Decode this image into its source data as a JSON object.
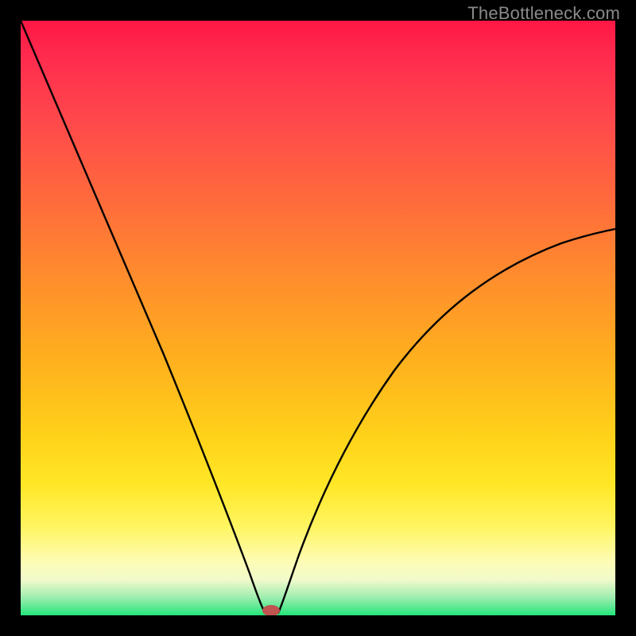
{
  "watermark": {
    "text": "TheBottleneck.com"
  },
  "chart_data": {
    "type": "line",
    "title": "",
    "xlabel": "",
    "ylabel": "",
    "xlim": [
      0,
      100
    ],
    "ylim": [
      0,
      100
    ],
    "grid": false,
    "legend": false,
    "series": [
      {
        "name": "bottleneck-curve",
        "x": [
          0,
          5,
          10,
          15,
          20,
          25,
          30,
          35,
          38,
          40,
          41,
          42,
          43,
          44,
          45,
          50,
          55,
          60,
          65,
          70,
          75,
          80,
          85,
          90,
          95,
          100
        ],
        "values": [
          100,
          88,
          76,
          64,
          52,
          40,
          28,
          15,
          6,
          2,
          1,
          0,
          1,
          2,
          4,
          12,
          20,
          27,
          33,
          38,
          43,
          47,
          50,
          53,
          56,
          58
        ]
      }
    ],
    "min_point": {
      "x": 42,
      "y": 0
    },
    "background_gradient": {
      "direction": "vertical",
      "stops": [
        {
          "pos": 0,
          "color": "#ff1744"
        },
        {
          "pos": 42,
          "color": "#ff8a2e"
        },
        {
          "pos": 78,
          "color": "#ffe726"
        },
        {
          "pos": 94,
          "color": "#f2facb"
        },
        {
          "pos": 100,
          "color": "#23e67b"
        }
      ]
    }
  }
}
